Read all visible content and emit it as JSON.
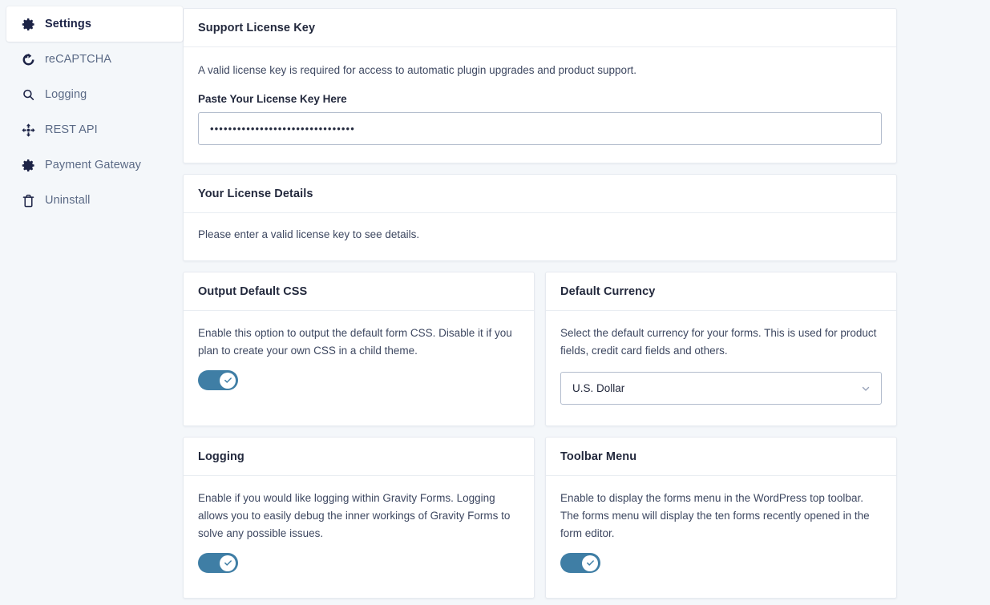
{
  "sidebar": {
    "items": [
      {
        "label": "Settings",
        "icon": "gear-icon",
        "active": true
      },
      {
        "label": "reCAPTCHA",
        "icon": "recaptcha-icon",
        "active": false
      },
      {
        "label": "Logging",
        "icon": "search-icon",
        "active": false
      },
      {
        "label": "REST API",
        "icon": "move-icon",
        "active": false
      },
      {
        "label": "Payment Gateway",
        "icon": "gear-icon",
        "active": false
      },
      {
        "label": "Uninstall",
        "icon": "trash-icon",
        "active": false
      }
    ]
  },
  "cards": {
    "license_key": {
      "title": "Support License Key",
      "description": "A valid license key is required for access to automatic plugin upgrades and product support.",
      "field_label": "Paste Your License Key Here",
      "input_value": "••••••••••••••••••••••••••••••••",
      "input_placeholder": ""
    },
    "license_details": {
      "title": "Your License Details",
      "description": "Please enter a valid license key to see details."
    },
    "output_default_css": {
      "title": "Output Default CSS",
      "description": "Enable this option to output the default form CSS. Disable it if you plan to create your own CSS in a child theme.",
      "toggle_state": "on"
    },
    "default_currency": {
      "title": "Default Currency",
      "description": "Select the default currency for your forms. This is used for product fields, credit card fields and others.",
      "selected": "U.S. Dollar"
    },
    "logging": {
      "title": "Logging",
      "description": "Enable if you would like logging within Gravity Forms. Logging allows you to easily debug the inner workings of Gravity Forms to solve any possible issues.",
      "toggle_state": "on"
    },
    "toolbar_menu": {
      "title": "Toolbar Menu",
      "description": "Enable to display the forms menu in the WordPress top toolbar. The forms menu will display the ten forms recently opened in the form editor.",
      "toggle_state": "on"
    }
  },
  "colors": {
    "page_background": "#f4f7fa",
    "card_background": "#ffffff",
    "card_border": "#e6eaf0",
    "toggle_on": "#3f7ea5",
    "heading_text": "#23293d",
    "body_text": "#3e4861",
    "nav_text": "#5b6a86"
  }
}
